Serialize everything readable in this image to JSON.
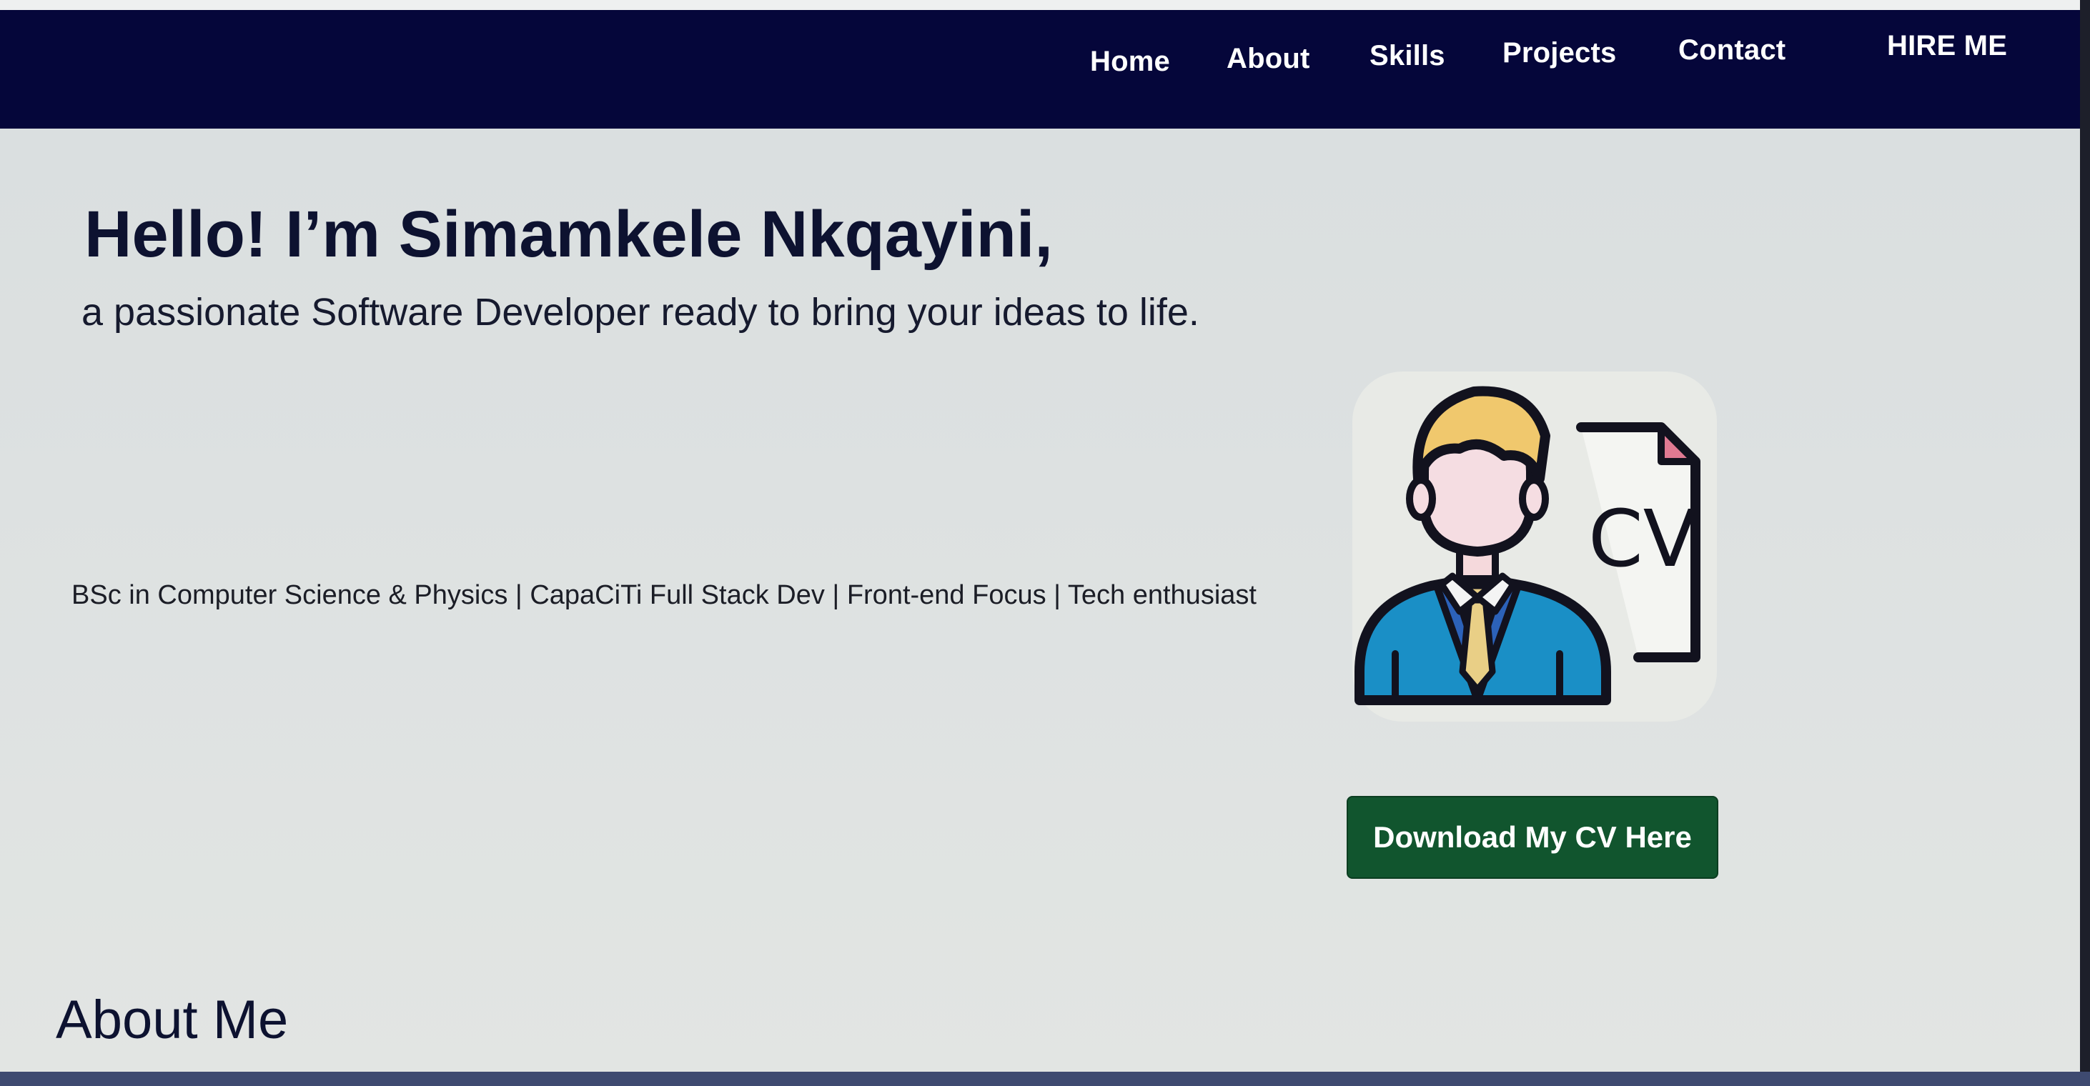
{
  "nav": {
    "items": [
      {
        "label": "Home"
      },
      {
        "label": "About"
      },
      {
        "label": "Skills"
      },
      {
        "label": "Projects"
      },
      {
        "label": "Contact"
      }
    ],
    "hire_me": "HIRE ME"
  },
  "hero": {
    "title": "Hello! I’m Simamkele Nkqayini,",
    "subtitle": "a passionate Software Developer ready to bring your ideas to life.",
    "tags": "BSc in Computer Science & Physics | CapaCiTi Full Stack Dev | Front-end Focus | Tech enthusiast",
    "cv_icon_text": "CV",
    "download_button": "Download My CV Here"
  },
  "about": {
    "heading": "About Me"
  },
  "colors": {
    "navbar": "#05063a",
    "button": "#11552e",
    "heading_text": "#0d1230"
  },
  "icons": [
    "developer-cv-icon"
  ]
}
